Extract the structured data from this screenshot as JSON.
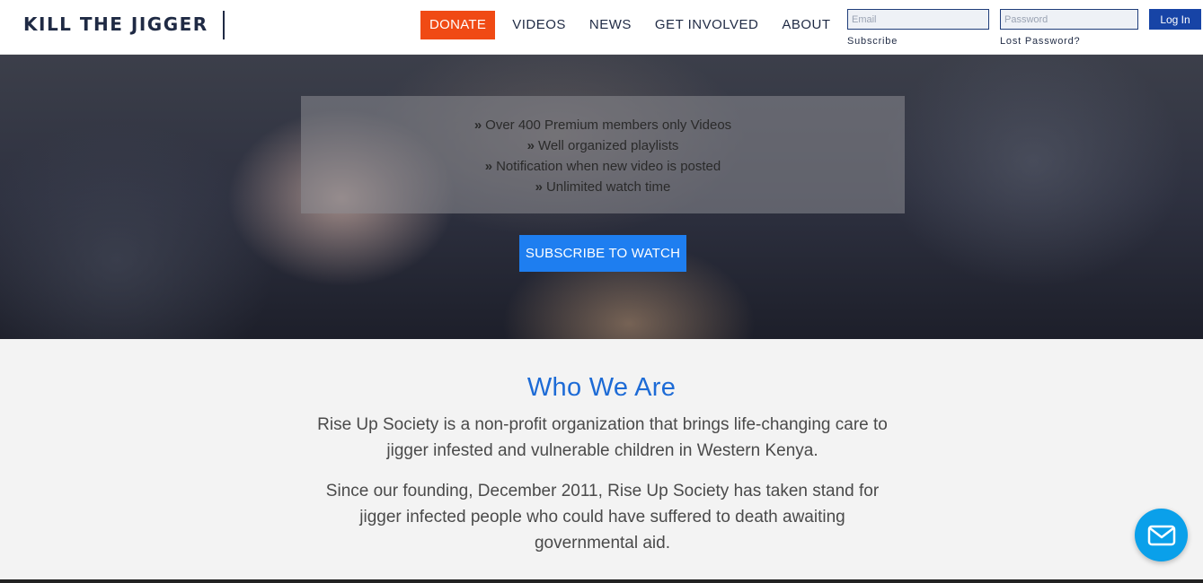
{
  "header": {
    "logo": "KILL THE JIGGER",
    "donate_label": "DONATE",
    "nav": [
      "VIDEOS",
      "NEWS",
      "GET INVOLVED",
      "ABOUT"
    ],
    "email_placeholder": "Email",
    "password_placeholder": "Password",
    "login_label": "Log In",
    "subscribe_link": "Subscribe",
    "lost_password_link": "Lost Password?"
  },
  "hero": {
    "features": [
      "Over 400 Premium members only Videos",
      "Well organized playlists",
      "Notification when new video is posted",
      "Unlimited watch time"
    ],
    "cta_label": "SUBSCRIBE TO WATCH"
  },
  "about": {
    "title": "Who We Are",
    "para1": "Rise Up Society is a non-profit organization that brings life-changing care to jigger infested and vulnerable children in Western Kenya.",
    "para2": "Since our founding, December 2011, Rise Up Society has taken stand for jigger infected people who could have suffered to death awaiting governmental aid."
  },
  "icons": {
    "feature_bullet": "double-chevron-right-icon",
    "chat": "envelope-icon"
  },
  "colors": {
    "donate": "#f04a14",
    "cta": "#1e7ef0",
    "title": "#1d6bd6",
    "login": "#1744a6",
    "chat": "#0aa0ea"
  }
}
